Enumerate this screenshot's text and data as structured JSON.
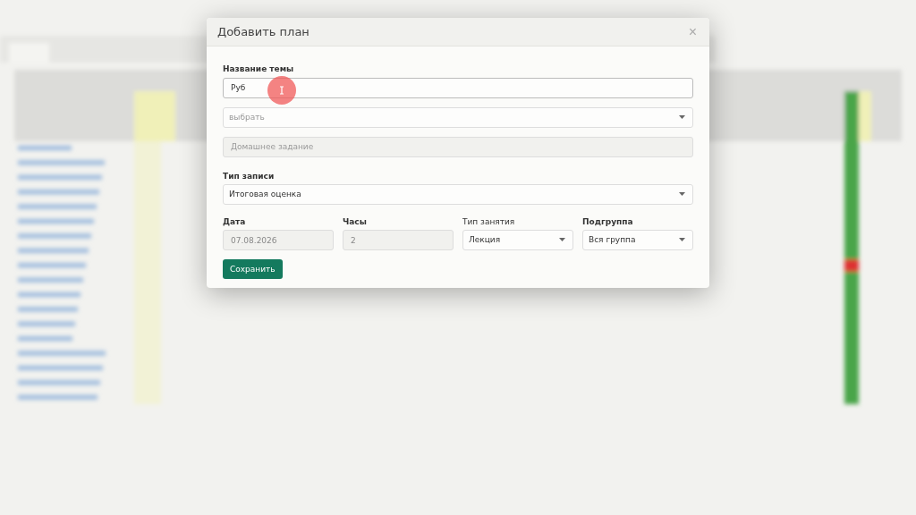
{
  "dialog": {
    "title": "Добавить план",
    "close": "×",
    "topic": {
      "label": "Название темы",
      "value": "Руб"
    },
    "select": {
      "placeholder": "выбрать"
    },
    "homework": {
      "placeholder": "Домашнее задание"
    },
    "record_type": {
      "label": "Тип записи",
      "value": "Итоговая оценка"
    },
    "row": [
      {
        "kind": "text",
        "label": "Дата",
        "bold": true,
        "value": "07.08.2026",
        "disabled": true
      },
      {
        "kind": "text",
        "label": "Часы",
        "bold": true,
        "value": "2",
        "disabled": true
      },
      {
        "kind": "select",
        "label": "Тип занятия",
        "bold": false,
        "value": "Лекция",
        "disabled": false
      },
      {
        "kind": "select",
        "label": "Подгруппа",
        "bold": true,
        "value": "Вся группа",
        "disabled": false
      }
    ],
    "save": "Сохранить"
  }
}
